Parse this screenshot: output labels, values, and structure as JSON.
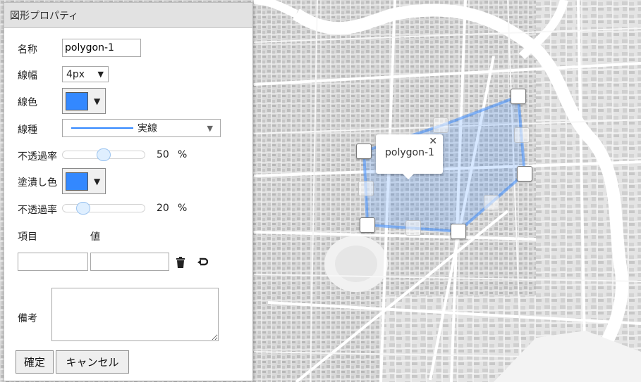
{
  "dialog": {
    "title": "図形プロパティ",
    "name_label": "名称",
    "name_value": "polygon-1",
    "line_width_label": "線幅",
    "line_width_value": "4px",
    "line_color_label": "線色",
    "line_type_label": "線種",
    "line_type_value": "実線",
    "line_opacity_label": "不透過率",
    "line_opacity_value": "50",
    "line_opacity_fraction": 0.5,
    "fill_color_label": "塗潰し色",
    "fill_opacity_label": "不透過率",
    "fill_opacity_value": "20",
    "fill_opacity_fraction": 0.2,
    "percent_unit": "%",
    "attr_key_header": "項目",
    "attr_value_header": "値",
    "attr_key_value": "",
    "attr_value_value": "",
    "notes_label": "備考",
    "notes_value": "",
    "confirm_button": "確定",
    "cancel_button": "キャンセル",
    "dropdown_arrow": "▼"
  },
  "colors": {
    "line_color": "#3388ff",
    "fill_color": "#3388ff"
  },
  "popup": {
    "text": "polygon-1",
    "close_symbol": "✕"
  },
  "icons": {
    "delete": "trash-icon",
    "undo": "return-arrow-icon",
    "close": "close-icon",
    "dropdown": "chevron-down-icon"
  }
}
